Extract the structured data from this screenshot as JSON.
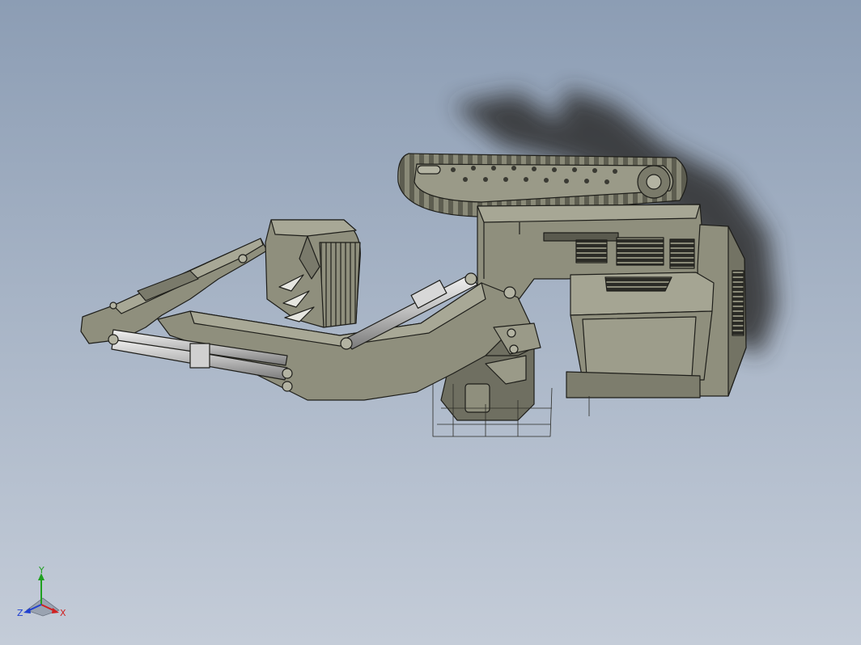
{
  "viewport": {
    "model": "excavator-assembly",
    "view": "isometric-underside",
    "colors": {
      "background_top": "#8c9db4",
      "background_bottom": "#c4ccd8",
      "body": "#8f8f7d",
      "body_dark": "#6e6e5f",
      "body_light": "#b3b3a2",
      "edge": "#1e1e1a",
      "cylinder": "#c8c8c8",
      "shadow": "#3a3a3a"
    }
  },
  "triad": {
    "x_label": "X",
    "y_label": "Y",
    "z_label": "Z",
    "x_color": "#d02020",
    "y_color": "#20a020",
    "z_color": "#2040d0"
  }
}
